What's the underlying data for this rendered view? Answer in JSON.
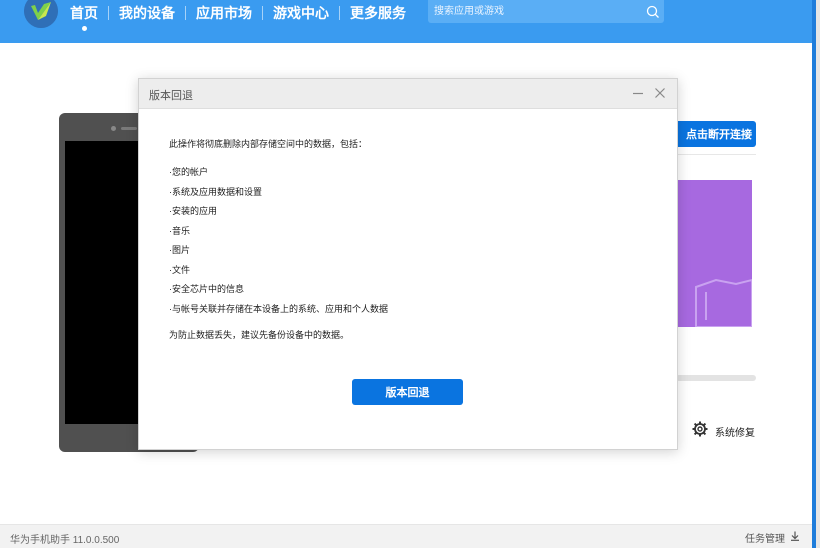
{
  "app": {
    "name_version": "华为手机助手 11.0.0.500",
    "accent_color": "#3a9bf0",
    "button_color": "#0a74e0"
  },
  "topbar": {
    "logo_icon": "huawei-hisuite-logo-icon",
    "nav": [
      {
        "label": "首页",
        "active": true
      },
      {
        "label": "我的设备"
      },
      {
        "label": "应用市场"
      },
      {
        "label": "游戏中心"
      },
      {
        "label": "更多服务"
      }
    ],
    "search": {
      "placeholder": "搜索应用或游戏",
      "icon": "search-icon"
    }
  },
  "device_panel": {
    "disconnect_label": "点击断开连接",
    "repair_label": "系统修复",
    "repair_icon": "gear-icon",
    "banner_color": "#a769e0"
  },
  "statusbar": {
    "tasks_label": "任务管理",
    "tasks_icon": "download-icon"
  },
  "dialog": {
    "title": "版本回退",
    "intro": "此操作将彻底删除内部存储空间中的数据，包括：",
    "items": [
      "·您的帐户",
      "·系统及应用数据和设置",
      "·安装的应用",
      "·音乐",
      "·图片",
      "·文件",
      "·安全芯片中的信息",
      "·与帐号关联并存储在本设备上的系统、应用和个人数据"
    ],
    "note": "为防止数据丢失，建议先备份设备中的数据。",
    "confirm_label": "版本回退",
    "minimize_icon": "minimize-icon",
    "close_icon": "close-icon"
  }
}
